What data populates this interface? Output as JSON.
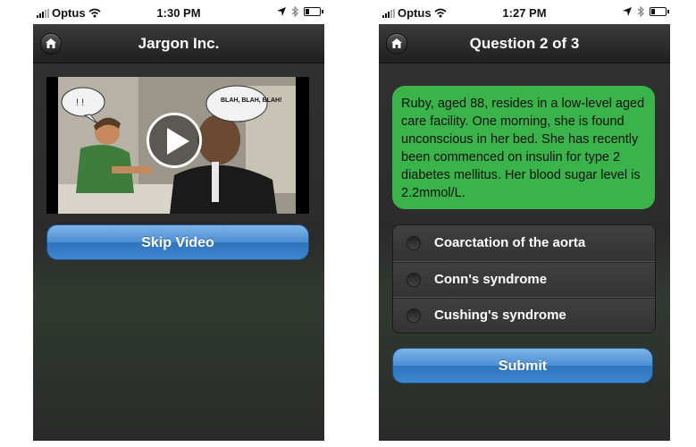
{
  "left_screen": {
    "status": {
      "carrier": "Optus",
      "time": "1:30 PM"
    },
    "nav": {
      "title": "Jargon Inc."
    },
    "video": {
      "speech_bubble_text": "BLAH, BLAH, BLAH!"
    },
    "skip_button_label": "Skip Video"
  },
  "right_screen": {
    "status": {
      "carrier": "Optus",
      "time": "1:27 PM"
    },
    "nav": {
      "title": "Question 2 of 3"
    },
    "question_text": "Ruby, aged 88, resides in a low-level aged care facility. One morning, she is found unconscious in her bed. She has recently been commenced on insulin for type 2 diabetes mellitus. Her blood sugar level is 2.2mmol/L.",
    "answers": [
      {
        "label": "Coarctation of the aorta"
      },
      {
        "label": "Conn's syndrome"
      },
      {
        "label": "Cushing's syndrome"
      }
    ],
    "submit_label": "Submit"
  },
  "icons": {
    "signal": "signal-bars-icon",
    "wifi": "wifi-icon",
    "location": "location-arrow-icon",
    "bluetooth": "bluetooth-icon",
    "battery": "battery-icon",
    "home": "home-icon",
    "play": "play-icon"
  },
  "colors": {
    "question_bubble": "#39b34a",
    "button_blue": "#4b8ed4",
    "nav_bar": "#2a2a2a"
  }
}
